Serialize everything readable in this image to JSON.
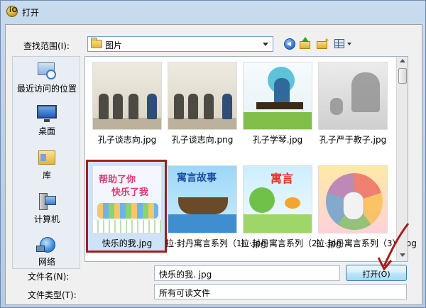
{
  "window": {
    "title": "打开",
    "app_icon": "app-logo-icon"
  },
  "toolbar": {
    "look_in_label": "查找范围(I):",
    "look_in_value": "图片",
    "icons": [
      "back-icon",
      "up-folder-icon",
      "new-folder-icon",
      "view-menu-icon"
    ]
  },
  "places": [
    {
      "label": "最近访问的位置",
      "icon": "recent-places-icon"
    },
    {
      "label": "桌面",
      "icon": "desktop-icon"
    },
    {
      "label": "库",
      "icon": "libraries-icon"
    },
    {
      "label": "计算机",
      "icon": "computer-icon"
    },
    {
      "label": "网络",
      "icon": "network-icon"
    }
  ],
  "files": [
    {
      "name": "孔子谈志向.jpg"
    },
    {
      "name": "孔子谈志向.png"
    },
    {
      "name": "孔子学琴.jpg"
    },
    {
      "name": "孔子严于教子.jpg"
    },
    {
      "name": "快乐的我.jpg",
      "selected": true,
      "pic_text_1": "帮助了你",
      "pic_text_2": "快乐了我"
    },
    {
      "name": "拉·封丹寓言系列（1）.jpg",
      "pic_text": "寓言故事"
    },
    {
      "name": "拉·封丹寓言系列（2）.jpg",
      "pic_text": "寓言"
    },
    {
      "name": "拉·封丹寓言系列（3）.jpg"
    }
  ],
  "bottom": {
    "file_name_label": "文件名(N):",
    "file_name_value": "快乐的我. jpg",
    "file_type_label": "文件类型(T):",
    "file_type_value": "所有可读文件",
    "open_button": "打开(O)"
  },
  "colors": {
    "selection_border": "#a61d1d",
    "annotation_arrow": "#a61d1d"
  }
}
